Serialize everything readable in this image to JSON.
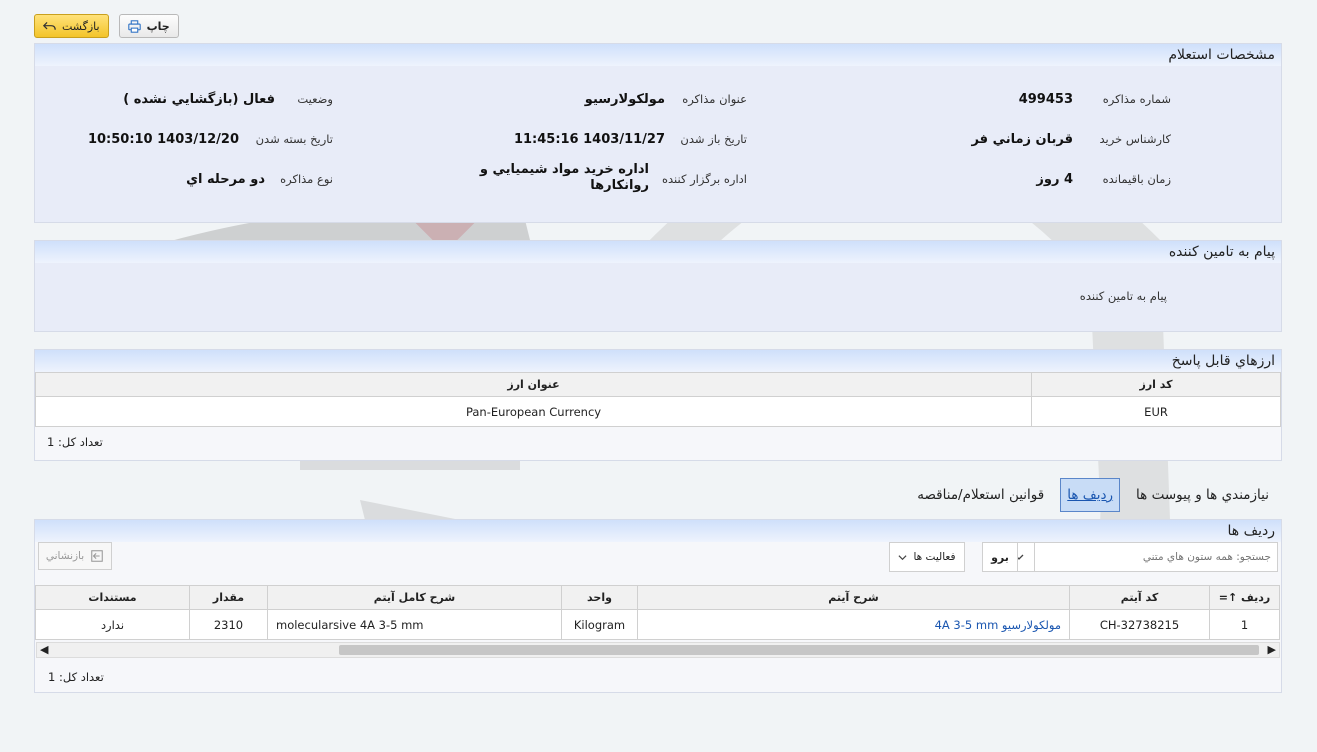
{
  "toolbar": {
    "back_label": "بازگشت",
    "print_label": "چاپ"
  },
  "inquiry": {
    "title": "مشخصات استعلام",
    "fields": [
      {
        "label": "شماره مذاکره",
        "value": "499453"
      },
      {
        "label": "عنوان مذاکره",
        "value": "مولکولارسيو"
      },
      {
        "label": "وضعيت",
        "value": "فعال (بازگشايي نشده )"
      },
      {
        "label": "کارشناس خريد",
        "value": "قربان زماني فر"
      },
      {
        "label": "تاريخ باز شدن",
        "value": "1403/11/27 11:45:16"
      },
      {
        "label": "تاريخ بسته شدن",
        "value": "1403/12/20 10:50:10"
      },
      {
        "label": "زمان باقيمانده",
        "value": "4 روز"
      },
      {
        "label": "اداره برگزار کننده",
        "value": "اداره خريد مواد شيميايي و روانكارها"
      },
      {
        "label": "نوع مذاکره",
        "value": "دو مرحله اي"
      }
    ]
  },
  "supplier_message": {
    "title": "پيام به تامين کننده",
    "label": "پيام به تامين کننده"
  },
  "currencies": {
    "title": "ارزهاي قابل پاسخ",
    "columns": [
      "کد ارز",
      "عنوان ارز"
    ],
    "rows": [
      [
        "EUR",
        "Pan-European Currency"
      ]
    ],
    "total": "تعداد کل: 1"
  },
  "tabs": [
    "نيازمندي ها و پيوست ها",
    "رديف ها",
    "قوانين استعلام/مناقصه"
  ],
  "rows_section": {
    "title": "رديف ها",
    "search_placeholder": "جستجو: همه ستون هاي متني",
    "go_label": "برو",
    "actions_label": "فعاليت ها",
    "restore_label": "بازنشاني",
    "columns": [
      "رديف",
      "کد آيتم",
      "شرح آيتم",
      "واحد",
      "شرح کامل آيتم",
      "مقدار",
      "مستندات"
    ],
    "rows": [
      [
        "1",
        "CH-32738215",
        "مولکولارسيو 4A 3-5 mm",
        "Kilogram",
        "molecularsive 4A 3-5 mm",
        "2310",
        "ندارد"
      ]
    ],
    "total": "تعداد کل: 1"
  },
  "colors": {
    "accent": "#1a56b0",
    "panel": "#e8ecf8",
    "back_button": "#f3c42a"
  }
}
